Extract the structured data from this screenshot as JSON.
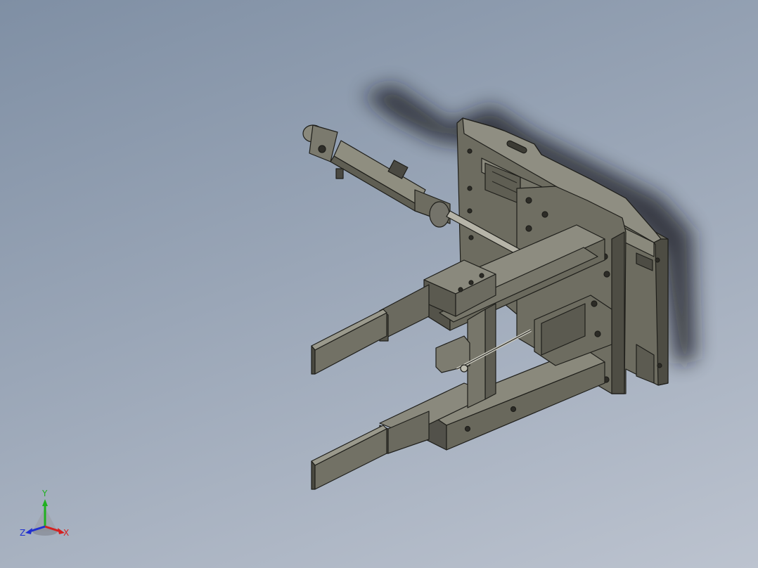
{
  "viewport": {
    "background_top": "#7f8fa4",
    "background_bottom": "#bcc3cf",
    "model_color": "#6b6a5e"
  },
  "triad": {
    "x_label": "X",
    "y_label": "Y",
    "z_label": "Z",
    "x_color": "#d42020",
    "y_color": "#20b020",
    "z_color": "#2030d0"
  }
}
